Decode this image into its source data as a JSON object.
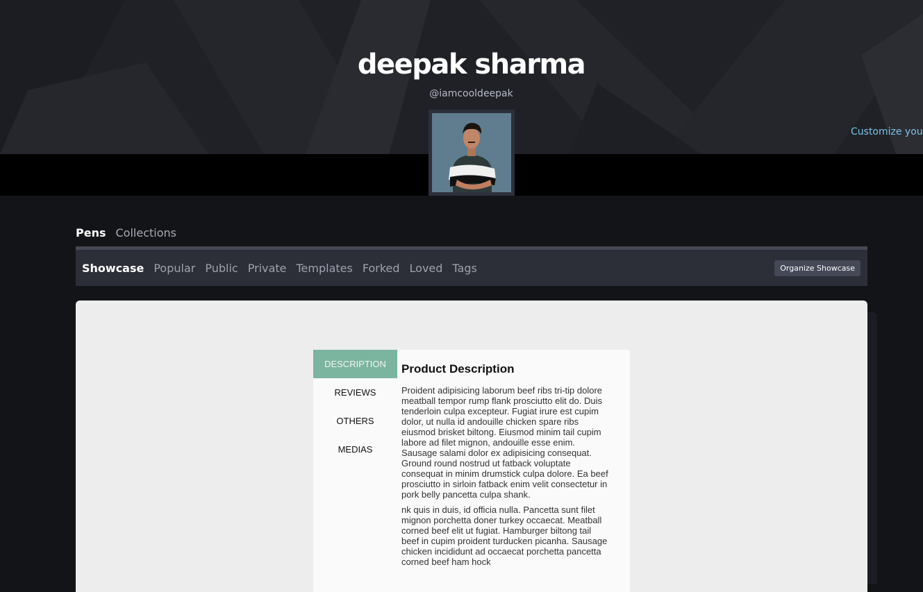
{
  "profile": {
    "name": "deepak sharma",
    "handle": "@iamcooldeepak",
    "customize_link": "Customize your"
  },
  "top_tabs": [
    {
      "label": "Pens",
      "active": true
    },
    {
      "label": "Collections",
      "active": false
    }
  ],
  "subnav": {
    "items": [
      {
        "label": "Showcase",
        "active": true
      },
      {
        "label": "Popular"
      },
      {
        "label": "Public"
      },
      {
        "label": "Private"
      },
      {
        "label": "Templates"
      },
      {
        "label": "Forked"
      },
      {
        "label": "Loved"
      },
      {
        "label": "Tags"
      }
    ],
    "organize_button": "Organize Showcase"
  },
  "pen_preview": {
    "tabs": [
      "DESCRIPTION",
      "REVIEWS",
      "OTHERS",
      "MEDIAS"
    ],
    "active_tab": "DESCRIPTION",
    "title": "Product Description",
    "paragraphs": [
      "Proident adipisicing laborum beef ribs tri-tip dolore meatball tempor rump flank prosciutto elit do. Duis tenderloin culpa excepteur. Fugiat irure est cupim dolor, ut nulla id andouille chicken spare ribs eiusmod brisket biltong. Eiusmod minim tail cupim labore ad filet mignon, andouille esse enim. Sausage salami dolor ex adipisicing consequat. Ground round nostrud ut fatback voluptate consequat in minim drumstick culpa dolore. Ea beef prosciutto in sirloin fatback enim velit consectetur in pork belly pancetta culpa shank.",
      "nk quis in duis, id officia nulla. Pancetta sunt filet mignon porchetta doner turkey occaecat. Meatball corned beef elit ut fugiat. Hamburger biltong tail beef in cupim proident turducken picanha. Sausage chicken incididunt ad occaecat porchetta pancetta corned beef ham hock"
    ]
  },
  "colors": {
    "accent_tab": "#7bb49f",
    "link": "#76c3e8",
    "page_bg": "#131417"
  }
}
